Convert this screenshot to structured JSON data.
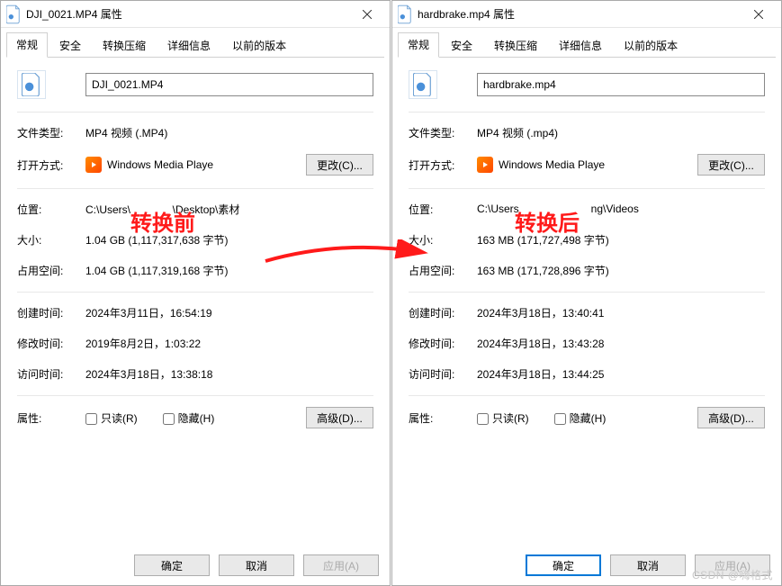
{
  "annotations": {
    "before": "转换前",
    "after": "转换后"
  },
  "watermark": "CSDN @嗨格式",
  "tabs": {
    "general": "常规",
    "security": "安全",
    "convert_compress": "转换压缩",
    "details": "详细信息",
    "previous_versions": "以前的版本"
  },
  "labels": {
    "file_type": "文件类型:",
    "open_with": "打开方式:",
    "location": "位置:",
    "size": "大小:",
    "size_on_disk": "占用空间:",
    "created": "创建时间:",
    "modified": "修改时间:",
    "accessed": "访问时间:",
    "attributes": "属性:",
    "readonly": "只读(R)",
    "hidden": "隐藏(H)"
  },
  "buttons": {
    "change": "更改(C)...",
    "advanced": "高级(D)...",
    "ok": "确定",
    "cancel": "取消",
    "apply": "应用(A)"
  },
  "left": {
    "title": "DJI_0021.MP4 属性",
    "filename": "DJI_0021.MP4",
    "file_type": "MP4 视频 (.MP4)",
    "open_with": "Windows Media Playe",
    "location": "C:\\Users\\              \\Desktop\\素材",
    "size": "1.04 GB (1,117,317,638 字节)",
    "size_on_disk": "1.04 GB (1,117,319,168 字节)",
    "created": "2024年3月11日，16:54:19",
    "modified": "2019年8月2日，1:03:22",
    "accessed": "2024年3月18日，13:38:18"
  },
  "right": {
    "title": "hardbrake.mp4 属性",
    "filename": "hardbrake.mp4",
    "file_type": "MP4 视频 (.mp4)",
    "open_with": "Windows Media Playe",
    "location": "C:\\Users                        ng\\Videos",
    "size": "163 MB (171,727,498 字节)",
    "size_on_disk": "163 MB (171,728,896 字节)",
    "created": "2024年3月18日，13:40:41",
    "modified": "2024年3月18日，13:43:28",
    "accessed": "2024年3月18日，13:44:25"
  }
}
